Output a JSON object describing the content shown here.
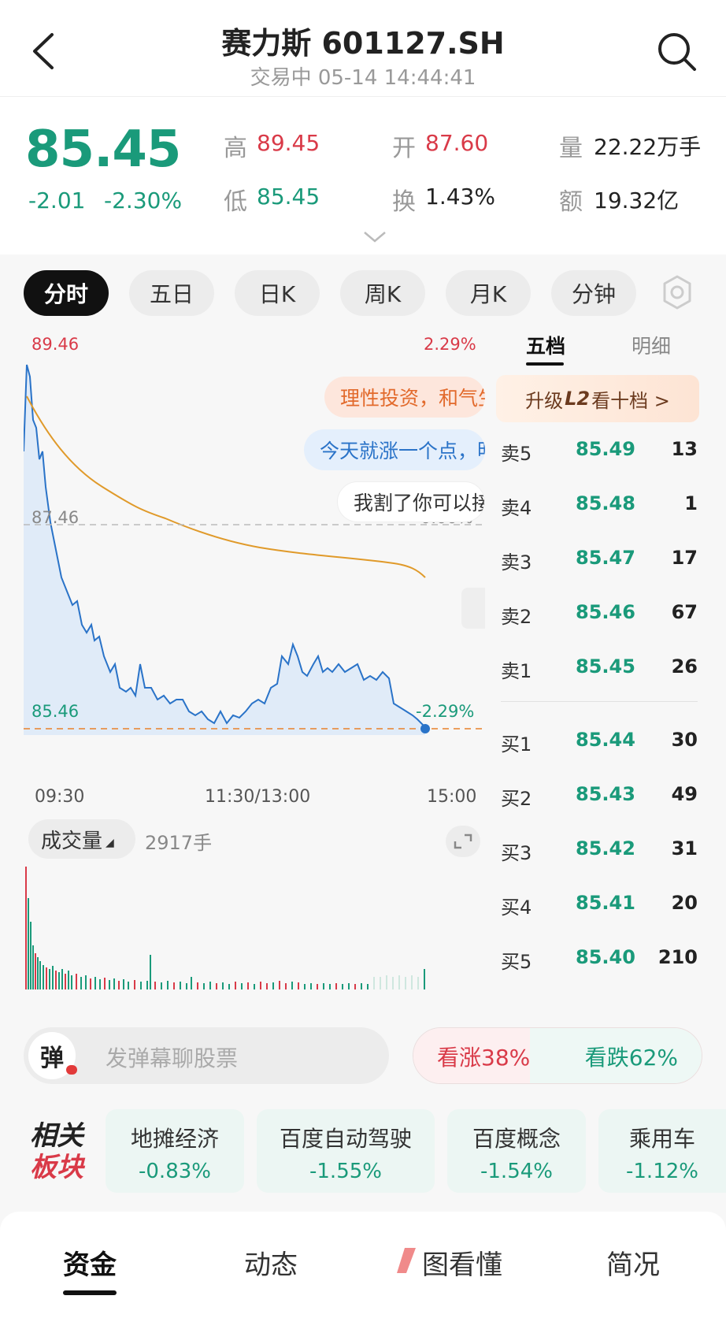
{
  "header": {
    "title": "赛力斯 601127.SH",
    "subtitle": "交易中 05-14 14:44:41"
  },
  "quote": {
    "price": "85.45",
    "change": "-2.01",
    "change_pct": "-2.30%",
    "high_label": "高",
    "high": "89.45",
    "low_label": "低",
    "low": "85.45",
    "open_label": "开",
    "open": "87.60",
    "turnover_label": "换",
    "turnover": "1.43%",
    "volume_label": "量",
    "volume": "22.22万手",
    "amount_label": "额",
    "amount": "19.32亿"
  },
  "tabs": [
    "分时",
    "五日",
    "日K",
    "周K",
    "月K",
    "分钟"
  ],
  "chart": {
    "y_top_price": "89.46",
    "y_top_pct": "2.29%",
    "y_mid_price": "87.46",
    "y_mid_pct": "0.00%",
    "y_bottom_price": "85.46",
    "y_bottom_pct": "-2.29%",
    "x_labels": [
      "09:30",
      "11:30/13:00",
      "15:00"
    ],
    "bubbles": [
      "理性投资，和气生财",
      "今天就涨一个点，明",
      "我割了你可以接"
    ],
    "colors": {
      "price_line": "#2a73c8",
      "avg_line": "#e09a2a",
      "area": "#dce9f8"
    }
  },
  "volume_panel": {
    "label": "成交量",
    "value": "2917手"
  },
  "order_book": {
    "tabs": [
      "五档",
      "明细"
    ],
    "upgrade_text": "升级",
    "upgrade_level": "L2",
    "upgrade_suffix": "看十档 >",
    "sell": [
      {
        "name": "卖5",
        "price": "85.49",
        "vol": "13"
      },
      {
        "name": "卖4",
        "price": "85.48",
        "vol": "1"
      },
      {
        "name": "卖3",
        "price": "85.47",
        "vol": "17"
      },
      {
        "name": "卖2",
        "price": "85.46",
        "vol": "67"
      },
      {
        "name": "卖1",
        "price": "85.45",
        "vol": "26"
      }
    ],
    "buy": [
      {
        "name": "买1",
        "price": "85.44",
        "vol": "30"
      },
      {
        "name": "买2",
        "price": "85.43",
        "vol": "49"
      },
      {
        "name": "买3",
        "price": "85.42",
        "vol": "31"
      },
      {
        "name": "买4",
        "price": "85.41",
        "vol": "20"
      },
      {
        "name": "买5",
        "price": "85.40",
        "vol": "210"
      }
    ]
  },
  "comment": {
    "icon_text": "弹",
    "placeholder": "发弹幕聊股票"
  },
  "sentiment": {
    "up": "看涨38%",
    "down": "看跌62%"
  },
  "related": {
    "title_line1": "相关",
    "title_line2": "板块",
    "items": [
      {
        "name": "地摊经济",
        "pct": "-0.83%"
      },
      {
        "name": "百度自动驾驶",
        "pct": "-1.55%"
      },
      {
        "name": "百度概念",
        "pct": "-1.54%"
      },
      {
        "name": "乘用车",
        "pct": "-1.12%"
      }
    ]
  },
  "bottom_tabs": [
    "资金",
    "动态",
    "图看懂",
    "简况"
  ]
}
